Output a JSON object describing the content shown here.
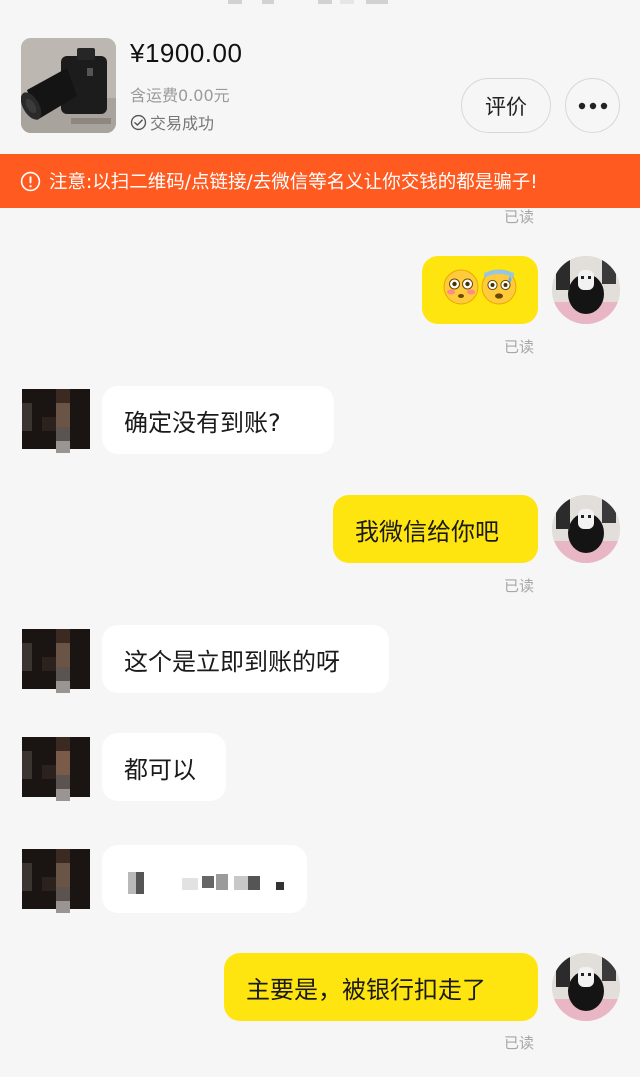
{
  "product": {
    "price": "¥1900.00",
    "shipping": "含运费0.00元",
    "status": "交易成功",
    "rate_label": "评价"
  },
  "warning": {
    "text": "注意:以扫二维码/点链接/去微信等名义让你交钱的都是骗子!"
  },
  "read_label": "已读",
  "messages": [
    {
      "from": "me",
      "text": "😳😰",
      "kind": "emoji"
    },
    {
      "from": "them",
      "text": "确定没有到账?"
    },
    {
      "from": "me",
      "text": "我微信给你吧"
    },
    {
      "from": "them",
      "text": "这个是立即到账的呀"
    },
    {
      "from": "them",
      "text": "都可以"
    },
    {
      "from": "them",
      "text": "",
      "kind": "redacted"
    },
    {
      "from": "me",
      "text": "主要是，被银行扣走了"
    }
  ],
  "colors": {
    "my_bubble": "#ffe50f",
    "their_bubble": "#ffffff",
    "warning_bg": "#ff5a20",
    "background": "#f6f6f6"
  }
}
